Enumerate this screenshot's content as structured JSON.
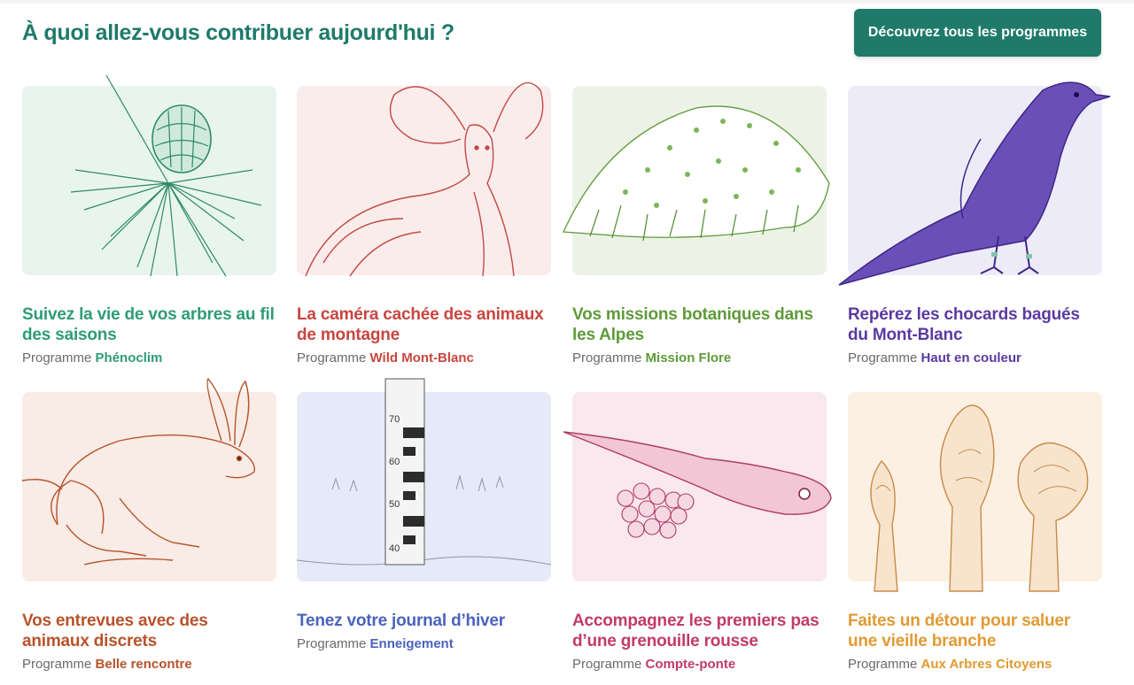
{
  "header": {
    "title": "À quoi allez-vous contribuer aujourd'hui ?",
    "cta_label": "Découvrez tous les programmes"
  },
  "cards": [
    {
      "title": "Suivez la vie de vos arbres au fil des saisons",
      "prefix": "Programme",
      "program": "Phénoclim",
      "color": "#2e9c76",
      "bg": "#e8f5ef",
      "illustration": "pine-cone-icon"
    },
    {
      "title": "La caméra cachée des animaux de montagne",
      "prefix": "Programme",
      "program": "Wild Mont-Blanc",
      "color": "#c8463f",
      "bg": "#fbecec",
      "illustration": "ibex-icon"
    },
    {
      "title": "Vos missions botaniques dans les Alpes",
      "prefix": "Programme",
      "program": "Mission Flore",
      "color": "#5f9a3a",
      "bg": "#ecf3e6",
      "illustration": "flower-cushion-icon"
    },
    {
      "title": "Repérez les chocards bagués du Mont-Blanc",
      "prefix": "Programme",
      "program": "Haut en couleur",
      "color": "#5a3aa0",
      "bg": "#eeebf8",
      "illustration": "chough-bird-icon"
    },
    {
      "title": "Vos entrevues avec des animaux discrets",
      "prefix": "Programme",
      "program": "Belle rencontre",
      "color": "#b8532a",
      "bg": "#f9ebe6",
      "illustration": "hare-icon"
    },
    {
      "title": "Tenez votre journal d’hiver",
      "prefix": "Programme",
      "program": "Enneigement",
      "color": "#4a63bd",
      "bg": "#e6eaf8",
      "illustration": "snow-pole-icon",
      "pole_marks": [
        "70",
        "60",
        "50",
        "40"
      ]
    },
    {
      "title": "Accompagnez les premiers pas d’une grenouille rousse",
      "prefix": "Programme",
      "program": "Compte-ponte",
      "color": "#c23a6a",
      "bg": "#f9e8ee",
      "illustration": "tadpole-icon"
    },
    {
      "title": "Faites un détour pour saluer une vieille branche",
      "prefix": "Programme",
      "program": "Aux Arbres Citoyens",
      "color": "#e29a33",
      "bg": "#fcf0e3",
      "illustration": "tree-buds-icon"
    }
  ]
}
